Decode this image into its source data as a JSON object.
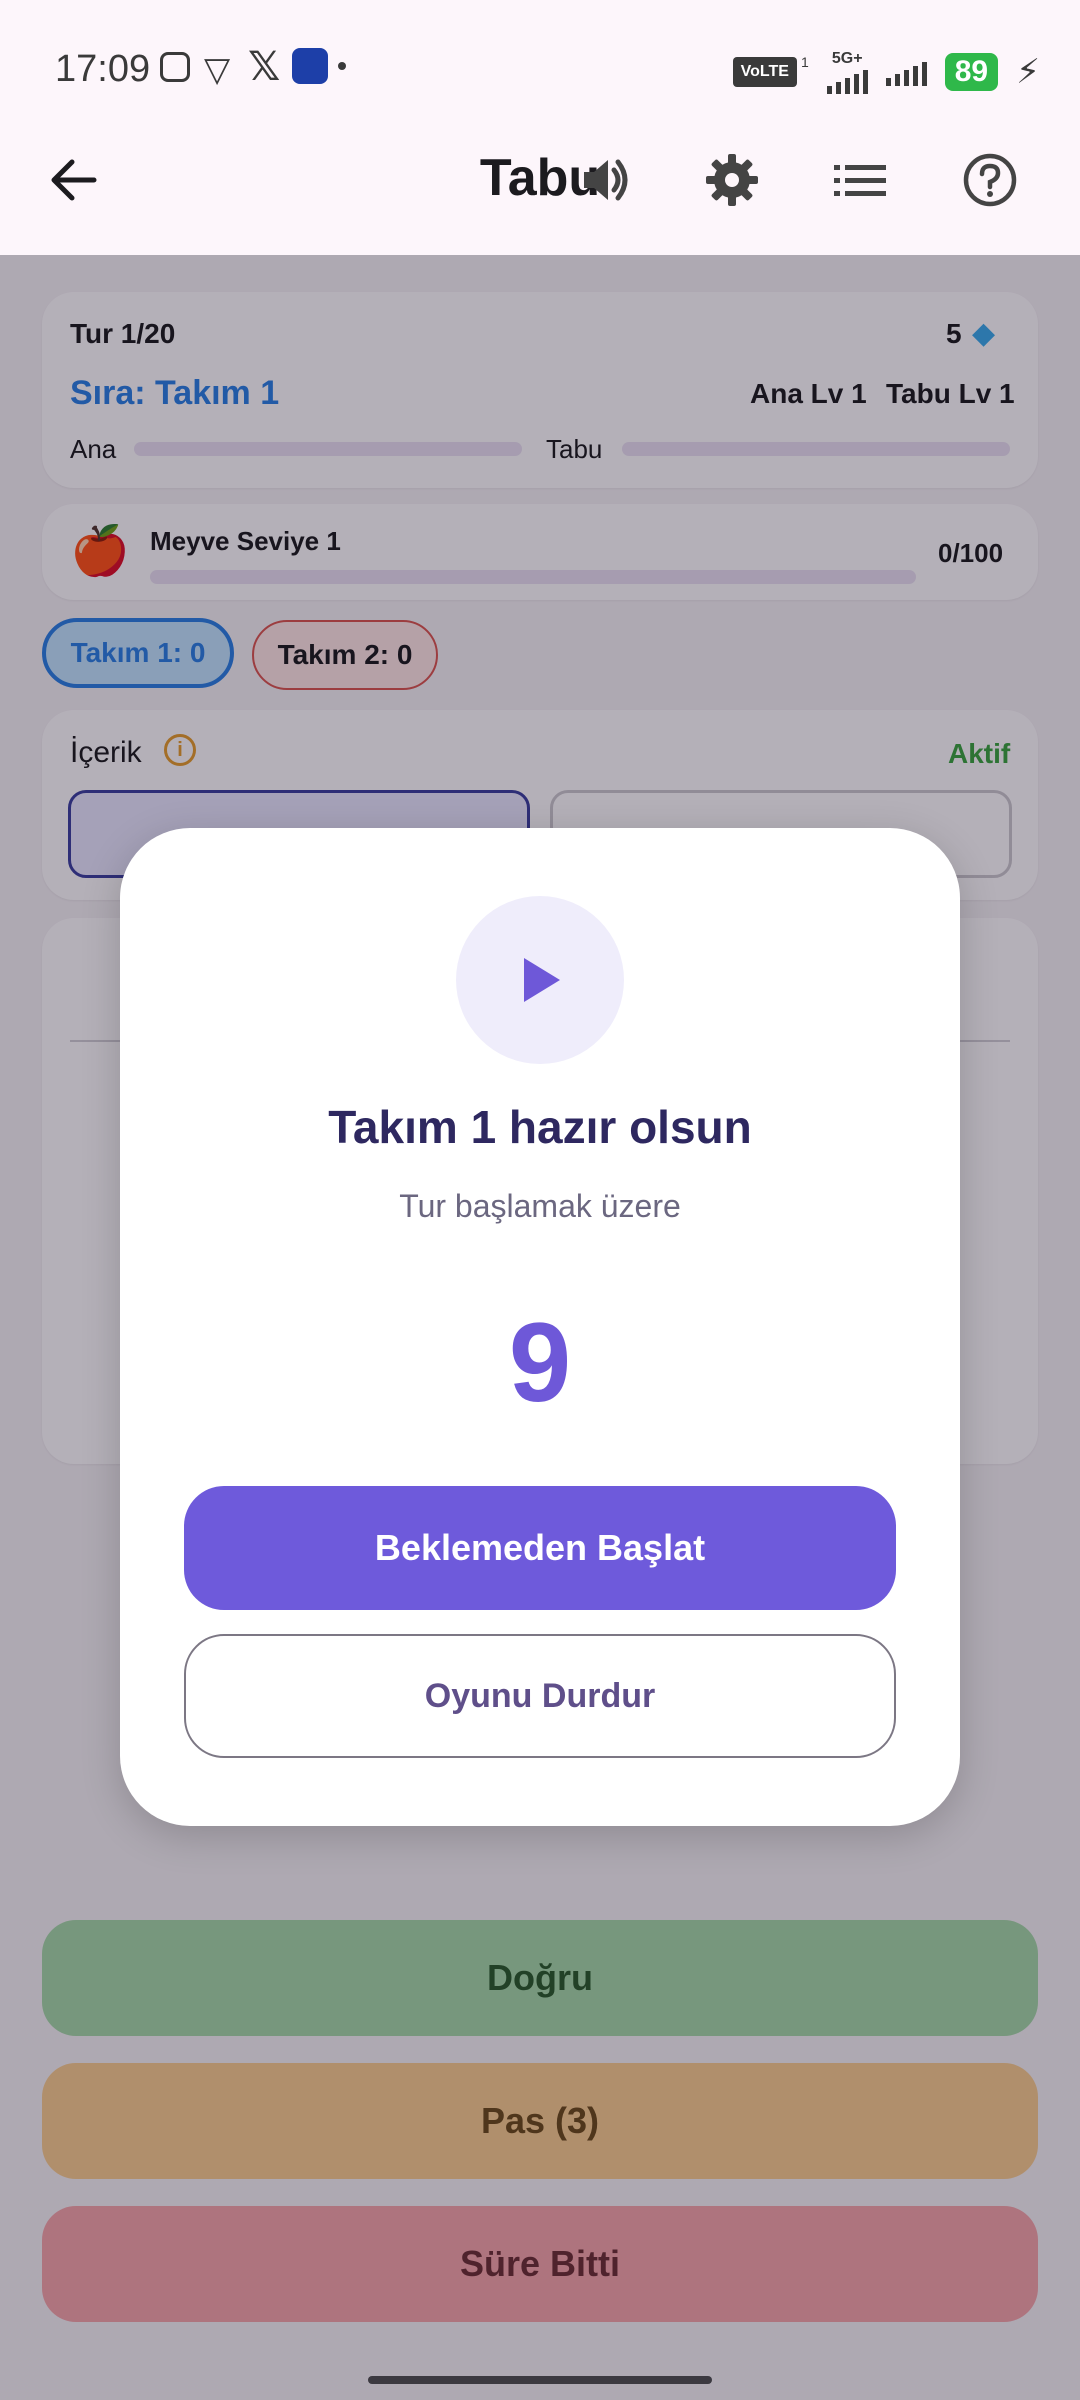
{
  "status_bar": {
    "time": "17:09",
    "volte": "VoLTE",
    "sim": "1",
    "network": "5G+",
    "battery": "89"
  },
  "app_bar": {
    "title": "Tabu"
  },
  "round_card": {
    "round": "Tur 1/20",
    "gems": "5",
    "turn": "Sıra: Takım 1",
    "ana_level": "Ana Lv 1",
    "tabu_level": "Tabu Lv 1",
    "ana_label": "Ana",
    "tabu_label": "Tabu"
  },
  "category_card": {
    "emoji": "🍎",
    "name": "Meyve Seviye 1",
    "progress": "0/100"
  },
  "teams": [
    {
      "label": "Takım 1: 0"
    },
    {
      "label": "Takım 2: 0"
    }
  ],
  "content_card": {
    "title": "İçerik",
    "status": "Aktif"
  },
  "bottom_buttons": {
    "correct": "Doğru",
    "pass": "Pas (3)",
    "timeout": "Süre Bitti"
  },
  "dialog": {
    "title": "Takım 1 hazır olsun",
    "subtitle": "Tur başlamak üzere",
    "countdown": "9",
    "primary_button": "Beklemeden Başlat",
    "secondary_button": "Oyunu Durdur"
  },
  "colors": {
    "accent": "#6e5adb",
    "team1": "#2a7de1",
    "team2": "#d9534f",
    "correct": "#a4d4a6",
    "pass": "#f5c98e",
    "timeout": "#f2a2a8"
  }
}
